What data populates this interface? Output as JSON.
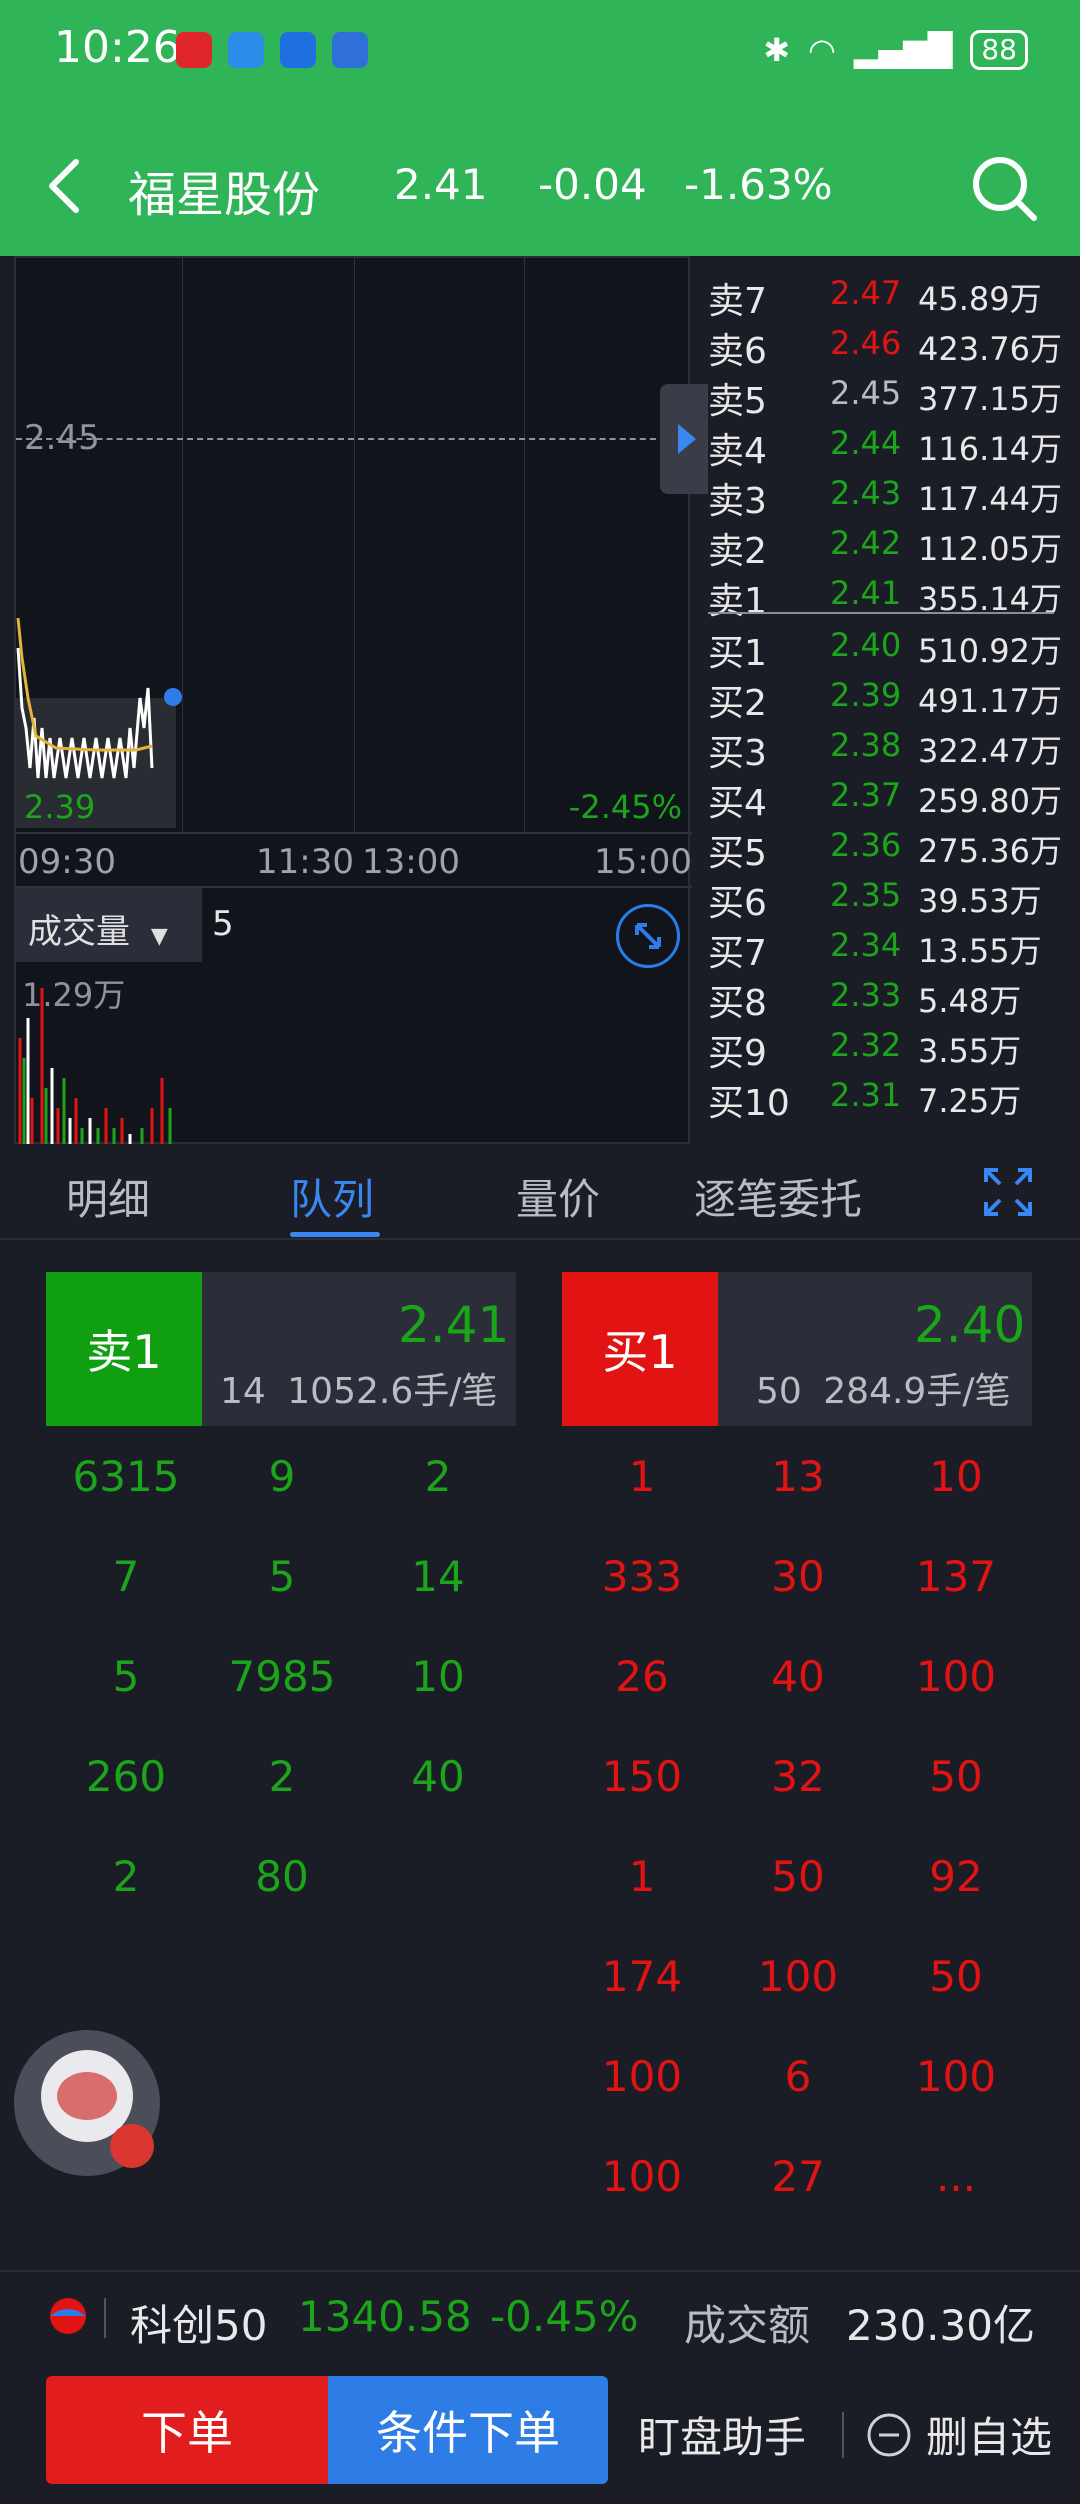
{
  "status": {
    "time": "10:26",
    "battery": "88"
  },
  "header": {
    "stock_name": "福星股份",
    "price": "2.41",
    "change": "-0.04",
    "pct": "-1.63%"
  },
  "chart": {
    "ref_price": "2.45",
    "low_price": "2.39",
    "low_pct": "-2.45%",
    "x_ticks": [
      "09:30",
      "11:30",
      "13:00",
      "15:00"
    ],
    "volume_label": "成交量",
    "volume_count": "5",
    "volume_max": "1.29万"
  },
  "book": {
    "asks": [
      {
        "label": "卖7",
        "price": "2.47",
        "qty": "45.89万",
        "color": "red"
      },
      {
        "label": "卖6",
        "price": "2.46",
        "qty": "423.76万",
        "color": "red"
      },
      {
        "label": "卖5",
        "price": "2.45",
        "qty": "377.15万",
        "color": "gray"
      },
      {
        "label": "卖4",
        "price": "2.44",
        "qty": "116.14万",
        "color": "green"
      },
      {
        "label": "卖3",
        "price": "2.43",
        "qty": "117.44万",
        "color": "green"
      },
      {
        "label": "卖2",
        "price": "2.42",
        "qty": "112.05万",
        "color": "green"
      },
      {
        "label": "卖1",
        "price": "2.41",
        "qty": "355.14万",
        "color": "green"
      }
    ],
    "bids": [
      {
        "label": "买1",
        "price": "2.40",
        "qty": "510.92万",
        "color": "green"
      },
      {
        "label": "买2",
        "price": "2.39",
        "qty": "491.17万",
        "color": "green"
      },
      {
        "label": "买3",
        "price": "2.38",
        "qty": "322.47万",
        "color": "green"
      },
      {
        "label": "买4",
        "price": "2.37",
        "qty": "259.80万",
        "color": "green"
      },
      {
        "label": "买5",
        "price": "2.36",
        "qty": "275.36万",
        "color": "green"
      },
      {
        "label": "买6",
        "price": "2.35",
        "qty": "39.53万",
        "color": "green"
      },
      {
        "label": "买7",
        "price": "2.34",
        "qty": "13.55万",
        "color": "green"
      },
      {
        "label": "买8",
        "price": "2.33",
        "qty": "5.48万",
        "color": "green"
      },
      {
        "label": "买9",
        "price": "2.32",
        "qty": "3.55万",
        "color": "green"
      },
      {
        "label": "买10",
        "price": "2.31",
        "qty": "7.25万",
        "color": "green"
      }
    ]
  },
  "tabs": [
    "明细",
    "队列",
    "量价",
    "逐笔委托"
  ],
  "queue": {
    "sell": {
      "tag": "卖1",
      "price": "2.41",
      "count": "14",
      "avg": "1052.6手/笔",
      "cells": [
        "6315",
        "9",
        "2",
        "7",
        "5",
        "14",
        "5",
        "7985",
        "10",
        "260",
        "2",
        "40",
        "2",
        "80"
      ]
    },
    "buy": {
      "tag": "买1",
      "price": "2.40",
      "count": "50",
      "avg": "284.9手/笔",
      "cells": [
        "1",
        "13",
        "10",
        "333",
        "30",
        "137",
        "26",
        "40",
        "100",
        "150",
        "32",
        "50",
        "1",
        "50",
        "92",
        "174",
        "100",
        "50",
        "100",
        "6",
        "100",
        "100",
        "27",
        "..."
      ]
    }
  },
  "index_bar": {
    "name": "科创50",
    "value": "1340.58",
    "pct": "-0.45%",
    "turnover_label": "成交额",
    "turnover": "230.30亿"
  },
  "actions": {
    "order": "下单",
    "conditional": "条件下单",
    "monitor": "盯盘助手",
    "remove": "删自选"
  },
  "colors": {
    "header_green": "#2fb557",
    "up_red": "#e21313",
    "down_green": "#1aa51a",
    "accent_blue": "#2e7ce6"
  }
}
